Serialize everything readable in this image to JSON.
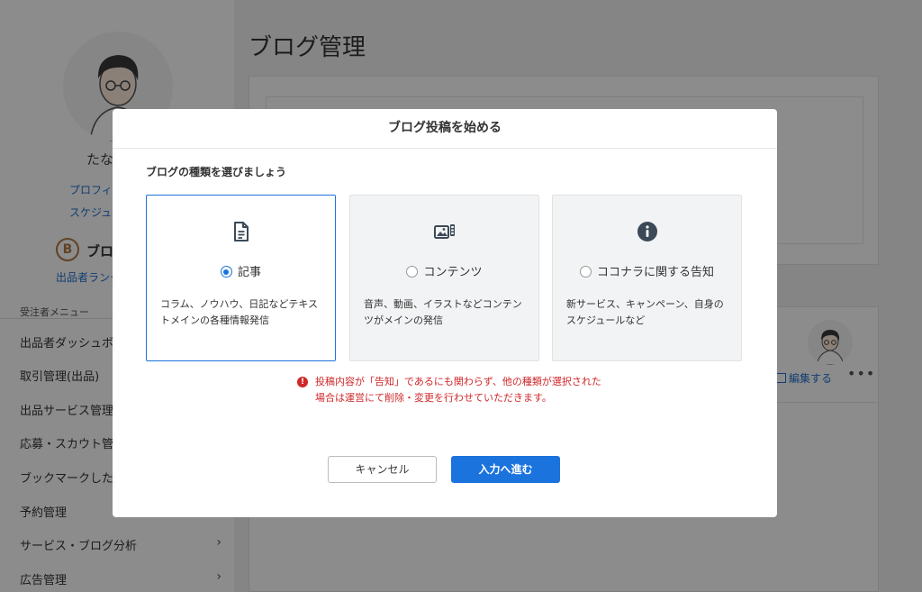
{
  "sidebar": {
    "user_name": "たな",
    "profile_link": "プロフィー",
    "schedule_link": "スケジュー",
    "rank_badge_letter": "B",
    "rank_title": "ブロ",
    "rank_link": "出品者ランク",
    "menu_header": "受注者メニュー",
    "menu_items": [
      "出品者ダッシュボ",
      "取引管理(出品)",
      "出品サービス管理",
      "応募・スカウト管",
      "ブックマークした",
      "予約管理",
      "サービス・ブログ分析",
      "広告管理"
    ],
    "chevron": "›"
  },
  "page": {
    "title": "ブログ管理",
    "edit_link": "編集する",
    "more": "•••"
  },
  "modal": {
    "title": "ブログ投稿を始める",
    "subtitle": "ブログの種類を選びましょう",
    "options": [
      {
        "label": "記事",
        "icon": "document-icon",
        "description": "コラム、ノウハウ、日記などテキストメインの各種情報発信",
        "selected": true
      },
      {
        "label": "コンテンツ",
        "icon": "media-icon",
        "description": "音声、動画、イラストなどコンテンツがメインの発信",
        "selected": false
      },
      {
        "label": "ココナラに関する告知",
        "icon": "info-icon",
        "description": "新サービス、キャンペーン、自身のスケジュールなど",
        "selected": false
      }
    ],
    "warning": "投稿内容が「告知」であるにも関わらず、他の種類が選択された場合は運営にて削除・変更を行わせていただきます。",
    "cancel_label": "キャンセル",
    "next_label": "入力へ進む"
  },
  "colors": {
    "accent": "#1b73dd",
    "warning": "#d0282a",
    "overlay": "rgba(0,0,0,0.45)"
  }
}
